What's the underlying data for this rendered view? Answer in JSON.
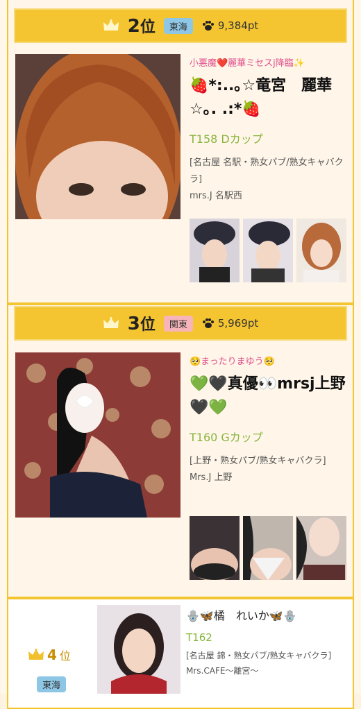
{
  "entries": [
    {
      "rank_num": "2",
      "rank_suffix": "位",
      "region": "東海",
      "points": "9,384pt",
      "catch": "小悪魔❤️麗華ミセスj降臨✨",
      "name": "🍓*:..｡☆竜宮　麗華☆｡. .:*🍓",
      "size": "T158 Dカップ",
      "category": "[名古屋 名駅・熟女パブ/熟女キャバクラ]",
      "shop": "mrs.J 名駅西"
    },
    {
      "rank_num": "3",
      "rank_suffix": "位",
      "region": "関東",
      "points": "5,969pt",
      "catch": "🥺まったりまゆう🥺",
      "name": "💚🖤真優👀mrsj上野🖤💚",
      "size": "T160 Gカップ",
      "category": "[上野・熟女パブ/熟女キャバクラ]",
      "shop": "Mrs.J 上野"
    },
    {
      "rank_num": "4",
      "rank_suffix": "位",
      "region": "東海",
      "name": "🪬🦋橘　れいか🦋🪬",
      "size": "T162",
      "category": "[名古屋 錦・熟女パブ/熟女キャバクラ]",
      "shop": "Mrs.CAFE〜離宮〜"
    }
  ],
  "colors": {
    "gold": "#f5c531",
    "pink": "#e0518d",
    "green": "#89b53f"
  },
  "icons": [
    "crown-icon",
    "paw-icon"
  ]
}
